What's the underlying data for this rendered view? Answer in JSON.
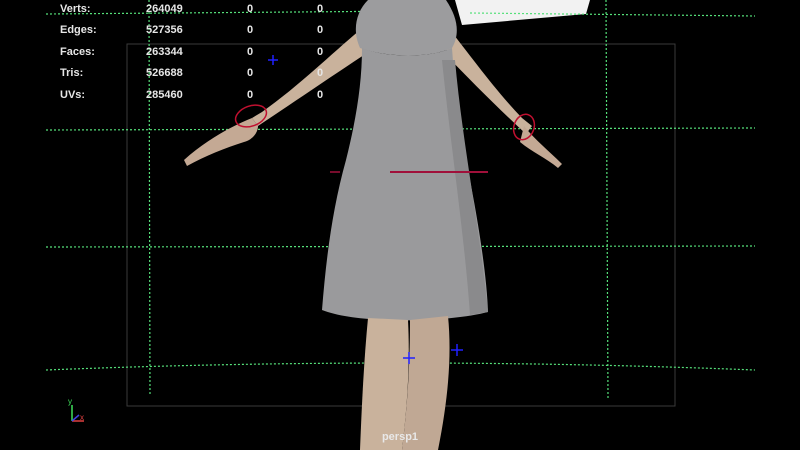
{
  "viewport": {
    "camera_name": "persp1",
    "background_color": "#000000",
    "grid_color": "#55e07a",
    "resolution_gate_color": "#3a3a3a",
    "model_color": "#9a9a9c",
    "skin_color": "#c9b29c"
  },
  "hud": {
    "rows": [
      {
        "label": "Verts:",
        "value": "264049",
        "zero1": "0",
        "zero2": "0"
      },
      {
        "label": "Edges:",
        "value": "527356",
        "zero1": "0",
        "zero2": "0"
      },
      {
        "label": "Faces:",
        "value": "263344",
        "zero1": "0",
        "zero2": "0"
      },
      {
        "label": "Tris:",
        "value": "526688",
        "zero1": "0",
        "zero2": "0"
      },
      {
        "label": "UVs:",
        "value": "285460",
        "zero1": "0",
        "zero2": "0"
      }
    ]
  },
  "axis": {
    "y_label": "y",
    "x_label": "x",
    "y_color": "#3de05a",
    "x_color": "#e04040"
  },
  "icons": {
    "joint_marker": "joint-cross-icon",
    "wrist_control": "wrist-control-icon",
    "axis_indicator": "axis-indicator-icon"
  }
}
